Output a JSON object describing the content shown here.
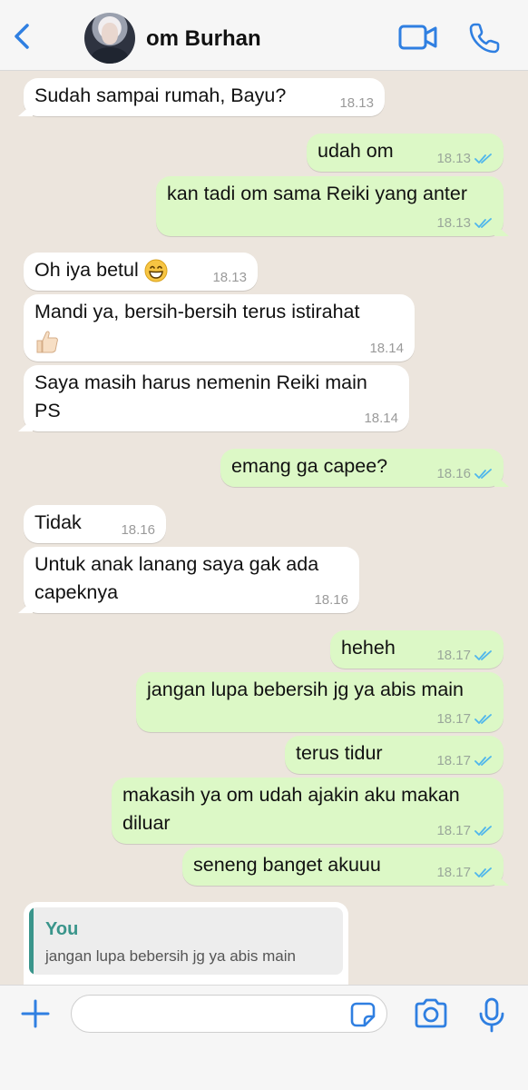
{
  "header": {
    "contact_name": "om Burhan",
    "back_icon": "chevron-left-icon",
    "video_icon": "video-camera-icon",
    "call_icon": "phone-icon"
  },
  "colors": {
    "accent": "#2f7fe1",
    "incoming_bubble": "#ffffff",
    "outgoing_bubble": "#dcf8c6",
    "chat_background": "#ece5dd",
    "read_ticks": "#4fb6ec",
    "reply_accent": "#3a958b"
  },
  "messages": [
    {
      "dir": "in",
      "text": "Sudah sampai rumah, Bayu?",
      "time": "18.13"
    },
    {
      "dir": "out",
      "text": "udah om",
      "time": "18.13",
      "status": "read"
    },
    {
      "dir": "out",
      "text": "kan tadi om sama Reiki yang anter",
      "time": "18.13",
      "status": "read"
    },
    {
      "dir": "in",
      "text": "Oh iya betul",
      "emoji": "grinning-face",
      "time": "18.13"
    },
    {
      "dir": "in",
      "text": "Mandi ya, bersih-bersih terus istirahat",
      "emoji": "thumbs-up",
      "time": "18.14"
    },
    {
      "dir": "in",
      "text": "Saya masih harus nemenin Reiki main PS",
      "time": "18.14"
    },
    {
      "dir": "out",
      "text": "emang ga capee?",
      "time": "18.16",
      "status": "read"
    },
    {
      "dir": "in",
      "text": "Tidak",
      "time": "18.16"
    },
    {
      "dir": "in",
      "text": "Untuk anak lanang saya gak ada capeknya",
      "time": "18.16"
    },
    {
      "dir": "out",
      "text": "heheh",
      "time": "18.17",
      "status": "read"
    },
    {
      "dir": "out",
      "text": "jangan lupa bebersih jg ya abis main",
      "time": "18.17",
      "status": "read"
    },
    {
      "dir": "out",
      "text": "terus tidur",
      "time": "18.17",
      "status": "read"
    },
    {
      "dir": "out",
      "text": "makasih ya om udah ajakin aku makan diluar",
      "time": "18.17",
      "status": "read"
    },
    {
      "dir": "out",
      "text": "seneng banget akuuu",
      "time": "18.17",
      "status": "read"
    }
  ],
  "reply_preview": {
    "author": "You",
    "quoted_text": "jangan lupa bebersih jg ya abis main"
  },
  "composer": {
    "input_value": "",
    "placeholder": "",
    "icons": [
      "plus-icon",
      "sticker-icon",
      "camera-icon",
      "microphone-icon"
    ]
  }
}
